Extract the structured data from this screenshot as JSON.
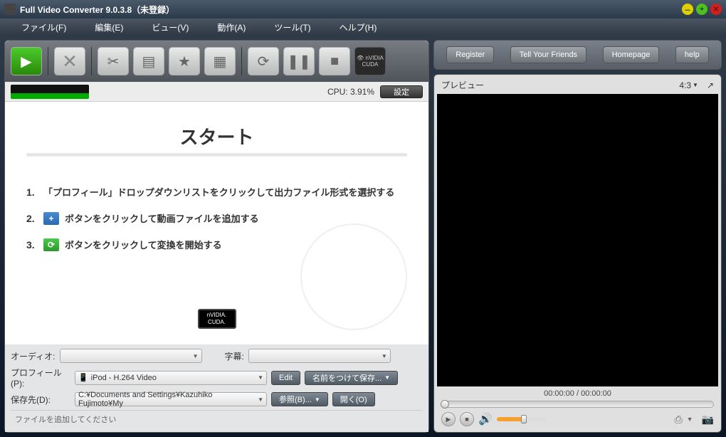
{
  "titlebar": {
    "title": "Full Video Converter 9.0.3.8（未登録）"
  },
  "menubar": {
    "file": "ファイル(F)",
    "edit": "編集(E)",
    "view": "ビュー(V)",
    "action": "動作(A)",
    "tool": "ツール(T)",
    "help": "ヘルプ(H)"
  },
  "cpu": {
    "label": "CPU: 3.91%",
    "settings": "設定"
  },
  "start": {
    "title": "スタート",
    "step1_num": "1.",
    "step1_text": "「プロフィール」ドロップダウンリストをクリックして出力ファイル形式を選択する",
    "step2_num": "2.",
    "step2_text": "ボタンをクリックして動画ファイルを追加する",
    "step3_num": "3.",
    "step3_text": "ボタンをクリックして変換を開始する"
  },
  "nvidia": {
    "line1": "nVIDIA.",
    "line2": "CUDA."
  },
  "bottom": {
    "audio_label": "オーディオ:",
    "subtitle_label": "字幕:",
    "profile_label": "プロフィール(P):",
    "profile_value": "iPod - H.264 Video",
    "edit_btn": "Edit",
    "saveas_btn": "名前をつけて保存...",
    "dest_label": "保存先(D):",
    "dest_value": "C:¥Documents and Settings¥Kazuhiko Fujimoto¥My",
    "browse_btn": "参照(B)...",
    "open_btn": "開く(O)",
    "status": "ファイルを追加してください"
  },
  "right": {
    "register": "Register",
    "tell": "Tell Your Friends",
    "homepage": "Homepage",
    "help": "help",
    "preview_title": "プレビュー",
    "aspect": "4:3",
    "time": "00:00:00 / 00:00:00"
  },
  "icons": {
    "add": "▶",
    "x": "✕",
    "cut": "✂",
    "clip": "▤",
    "star": "★",
    "addclip": "▦",
    "refresh": "⟳",
    "pause": "❚❚",
    "stop": "■",
    "cuda1": "👁 nVIDIA",
    "cuda2": "CUDA",
    "film_icon": "+",
    "refresh_icon": "⟳",
    "speaker": "🔊",
    "play": "▶",
    "stop_sm": "■",
    "aspect_arrow": "▼",
    "popout": "↗",
    "cam": "📷",
    "snap": "⎙"
  }
}
